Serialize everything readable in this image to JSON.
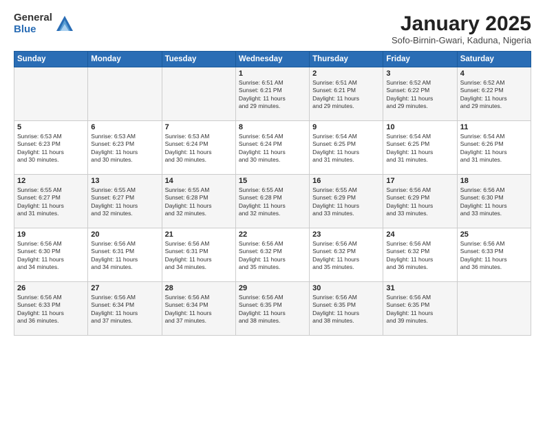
{
  "header": {
    "logo_general": "General",
    "logo_blue": "Blue",
    "title": "January 2025",
    "location": "Sofo-Birnin-Gwari, Kaduna, Nigeria"
  },
  "days_of_week": [
    "Sunday",
    "Monday",
    "Tuesday",
    "Wednesday",
    "Thursday",
    "Friday",
    "Saturday"
  ],
  "weeks": [
    [
      {
        "day": "",
        "info": ""
      },
      {
        "day": "",
        "info": ""
      },
      {
        "day": "",
        "info": ""
      },
      {
        "day": "1",
        "info": "Sunrise: 6:51 AM\nSunset: 6:21 PM\nDaylight: 11 hours\nand 29 minutes."
      },
      {
        "day": "2",
        "info": "Sunrise: 6:51 AM\nSunset: 6:21 PM\nDaylight: 11 hours\nand 29 minutes."
      },
      {
        "day": "3",
        "info": "Sunrise: 6:52 AM\nSunset: 6:22 PM\nDaylight: 11 hours\nand 29 minutes."
      },
      {
        "day": "4",
        "info": "Sunrise: 6:52 AM\nSunset: 6:22 PM\nDaylight: 11 hours\nand 29 minutes."
      }
    ],
    [
      {
        "day": "5",
        "info": "Sunrise: 6:53 AM\nSunset: 6:23 PM\nDaylight: 11 hours\nand 30 minutes."
      },
      {
        "day": "6",
        "info": "Sunrise: 6:53 AM\nSunset: 6:23 PM\nDaylight: 11 hours\nand 30 minutes."
      },
      {
        "day": "7",
        "info": "Sunrise: 6:53 AM\nSunset: 6:24 PM\nDaylight: 11 hours\nand 30 minutes."
      },
      {
        "day": "8",
        "info": "Sunrise: 6:54 AM\nSunset: 6:24 PM\nDaylight: 11 hours\nand 30 minutes."
      },
      {
        "day": "9",
        "info": "Sunrise: 6:54 AM\nSunset: 6:25 PM\nDaylight: 11 hours\nand 31 minutes."
      },
      {
        "day": "10",
        "info": "Sunrise: 6:54 AM\nSunset: 6:25 PM\nDaylight: 11 hours\nand 31 minutes."
      },
      {
        "day": "11",
        "info": "Sunrise: 6:54 AM\nSunset: 6:26 PM\nDaylight: 11 hours\nand 31 minutes."
      }
    ],
    [
      {
        "day": "12",
        "info": "Sunrise: 6:55 AM\nSunset: 6:27 PM\nDaylight: 11 hours\nand 31 minutes."
      },
      {
        "day": "13",
        "info": "Sunrise: 6:55 AM\nSunset: 6:27 PM\nDaylight: 11 hours\nand 32 minutes."
      },
      {
        "day": "14",
        "info": "Sunrise: 6:55 AM\nSunset: 6:28 PM\nDaylight: 11 hours\nand 32 minutes."
      },
      {
        "day": "15",
        "info": "Sunrise: 6:55 AM\nSunset: 6:28 PM\nDaylight: 11 hours\nand 32 minutes."
      },
      {
        "day": "16",
        "info": "Sunrise: 6:55 AM\nSunset: 6:29 PM\nDaylight: 11 hours\nand 33 minutes."
      },
      {
        "day": "17",
        "info": "Sunrise: 6:56 AM\nSunset: 6:29 PM\nDaylight: 11 hours\nand 33 minutes."
      },
      {
        "day": "18",
        "info": "Sunrise: 6:56 AM\nSunset: 6:30 PM\nDaylight: 11 hours\nand 33 minutes."
      }
    ],
    [
      {
        "day": "19",
        "info": "Sunrise: 6:56 AM\nSunset: 6:30 PM\nDaylight: 11 hours\nand 34 minutes."
      },
      {
        "day": "20",
        "info": "Sunrise: 6:56 AM\nSunset: 6:31 PM\nDaylight: 11 hours\nand 34 minutes."
      },
      {
        "day": "21",
        "info": "Sunrise: 6:56 AM\nSunset: 6:31 PM\nDaylight: 11 hours\nand 34 minutes."
      },
      {
        "day": "22",
        "info": "Sunrise: 6:56 AM\nSunset: 6:32 PM\nDaylight: 11 hours\nand 35 minutes."
      },
      {
        "day": "23",
        "info": "Sunrise: 6:56 AM\nSunset: 6:32 PM\nDaylight: 11 hours\nand 35 minutes."
      },
      {
        "day": "24",
        "info": "Sunrise: 6:56 AM\nSunset: 6:32 PM\nDaylight: 11 hours\nand 36 minutes."
      },
      {
        "day": "25",
        "info": "Sunrise: 6:56 AM\nSunset: 6:33 PM\nDaylight: 11 hours\nand 36 minutes."
      }
    ],
    [
      {
        "day": "26",
        "info": "Sunrise: 6:56 AM\nSunset: 6:33 PM\nDaylight: 11 hours\nand 36 minutes."
      },
      {
        "day": "27",
        "info": "Sunrise: 6:56 AM\nSunset: 6:34 PM\nDaylight: 11 hours\nand 37 minutes."
      },
      {
        "day": "28",
        "info": "Sunrise: 6:56 AM\nSunset: 6:34 PM\nDaylight: 11 hours\nand 37 minutes."
      },
      {
        "day": "29",
        "info": "Sunrise: 6:56 AM\nSunset: 6:35 PM\nDaylight: 11 hours\nand 38 minutes."
      },
      {
        "day": "30",
        "info": "Sunrise: 6:56 AM\nSunset: 6:35 PM\nDaylight: 11 hours\nand 38 minutes."
      },
      {
        "day": "31",
        "info": "Sunrise: 6:56 AM\nSunset: 6:35 PM\nDaylight: 11 hours\nand 39 minutes."
      },
      {
        "day": "",
        "info": ""
      }
    ]
  ]
}
